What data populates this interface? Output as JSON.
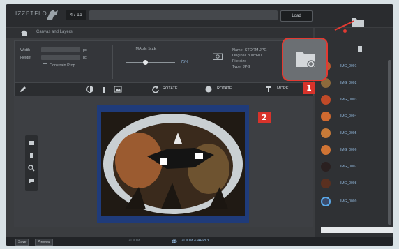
{
  "topbar": {
    "logo": "IZZETFLO",
    "counter": "4 / 16",
    "load_label": "Load"
  },
  "breadcrumb": {
    "text": "Canvas and Layers"
  },
  "dimensions": {
    "width_label": "Width",
    "height_label": "Height",
    "unit": "px",
    "constrain_label": "Constrain Prop."
  },
  "quality": {
    "label": "IMAGE SIZE",
    "value": "75%"
  },
  "file_info": {
    "name": "Name: STORM.JPG",
    "line2": "Original: 800x601",
    "line3": "File size",
    "line4": "Type: JPG"
  },
  "toolbar": {
    "rotate_label": "ROTATE",
    "flip_label": "ROTATE",
    "text_label": "MORE"
  },
  "sidebar": {
    "items": [
      "IMG_0001",
      "IMG_0002",
      "IMG_0003",
      "IMG_0004",
      "IMG_0005",
      "IMG_0006",
      "IMG_0007",
      "IMG_0008",
      "IMG_0009"
    ]
  },
  "bottombar": {
    "btn1": "Save",
    "btn2": "Preview",
    "zoom_prefix": "ZOOM",
    "zoom_value": "ZOOM & APPLY"
  },
  "annotations": {
    "badge1": "1",
    "badge2": "2"
  },
  "colors": {
    "accent_red": "#d8332b",
    "link_blue": "#8fb5d9"
  }
}
